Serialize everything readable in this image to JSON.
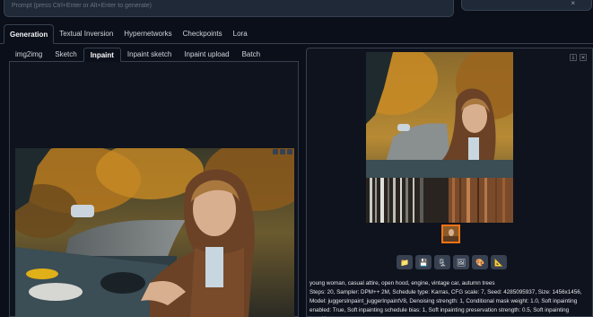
{
  "prompt": {
    "placeholder": "Prompt (press Ctrl+Enter or Alt+Enter to generate)"
  },
  "top_right": {
    "close_glyph": "×"
  },
  "main_tabs": [
    {
      "label": "Generation",
      "active": true
    },
    {
      "label": "Textual Inversion",
      "active": false
    },
    {
      "label": "Hypernetworks",
      "active": false
    },
    {
      "label": "Checkpoints",
      "active": false
    },
    {
      "label": "Lora",
      "active": false
    }
  ],
  "sub_tabs": [
    {
      "label": "img2img",
      "active": false
    },
    {
      "label": "Sketch",
      "active": false
    },
    {
      "label": "Inpaint",
      "active": true
    },
    {
      "label": "Inpaint sketch",
      "active": false
    },
    {
      "label": "Inpaint upload",
      "active": false
    },
    {
      "label": "Batch",
      "active": false
    }
  ],
  "result_panel": {
    "corner_buttons": [
      "⤓",
      "✕"
    ],
    "actions": [
      {
        "icon": "folder-icon",
        "glyph": "📁"
      },
      {
        "icon": "save-icon",
        "glyph": "💾"
      },
      {
        "icon": "zip-icon",
        "glyph": "🗜"
      },
      {
        "icon": "send-to-img2img-icon",
        "glyph": "🖼"
      },
      {
        "icon": "palette-icon",
        "glyph": "🎨"
      },
      {
        "icon": "ruler-icon",
        "glyph": "📐"
      }
    ],
    "caption": "young woman, casual attire, open hood, engine, vintage car, autumn trees",
    "params": "Steps: 20, Sampler: DPM++ 2M, Schedule type: Karras, CFG scale: 7, Seed: 4285095937, Size: 1456x1456, Model: juggersInpaint_juggerInpaintV8, Denoising strength: 1, Conditional mask weight: 1.0, Soft inpainting enabled: True, Soft inpainting schedule bias: 1, Soft inpainting preservation strength: 0.5, Soft inpainting transition"
  },
  "colors": {
    "background": "#0b0f19",
    "panel": "#0f131d",
    "border": "#374151",
    "accent": "#f97316"
  }
}
